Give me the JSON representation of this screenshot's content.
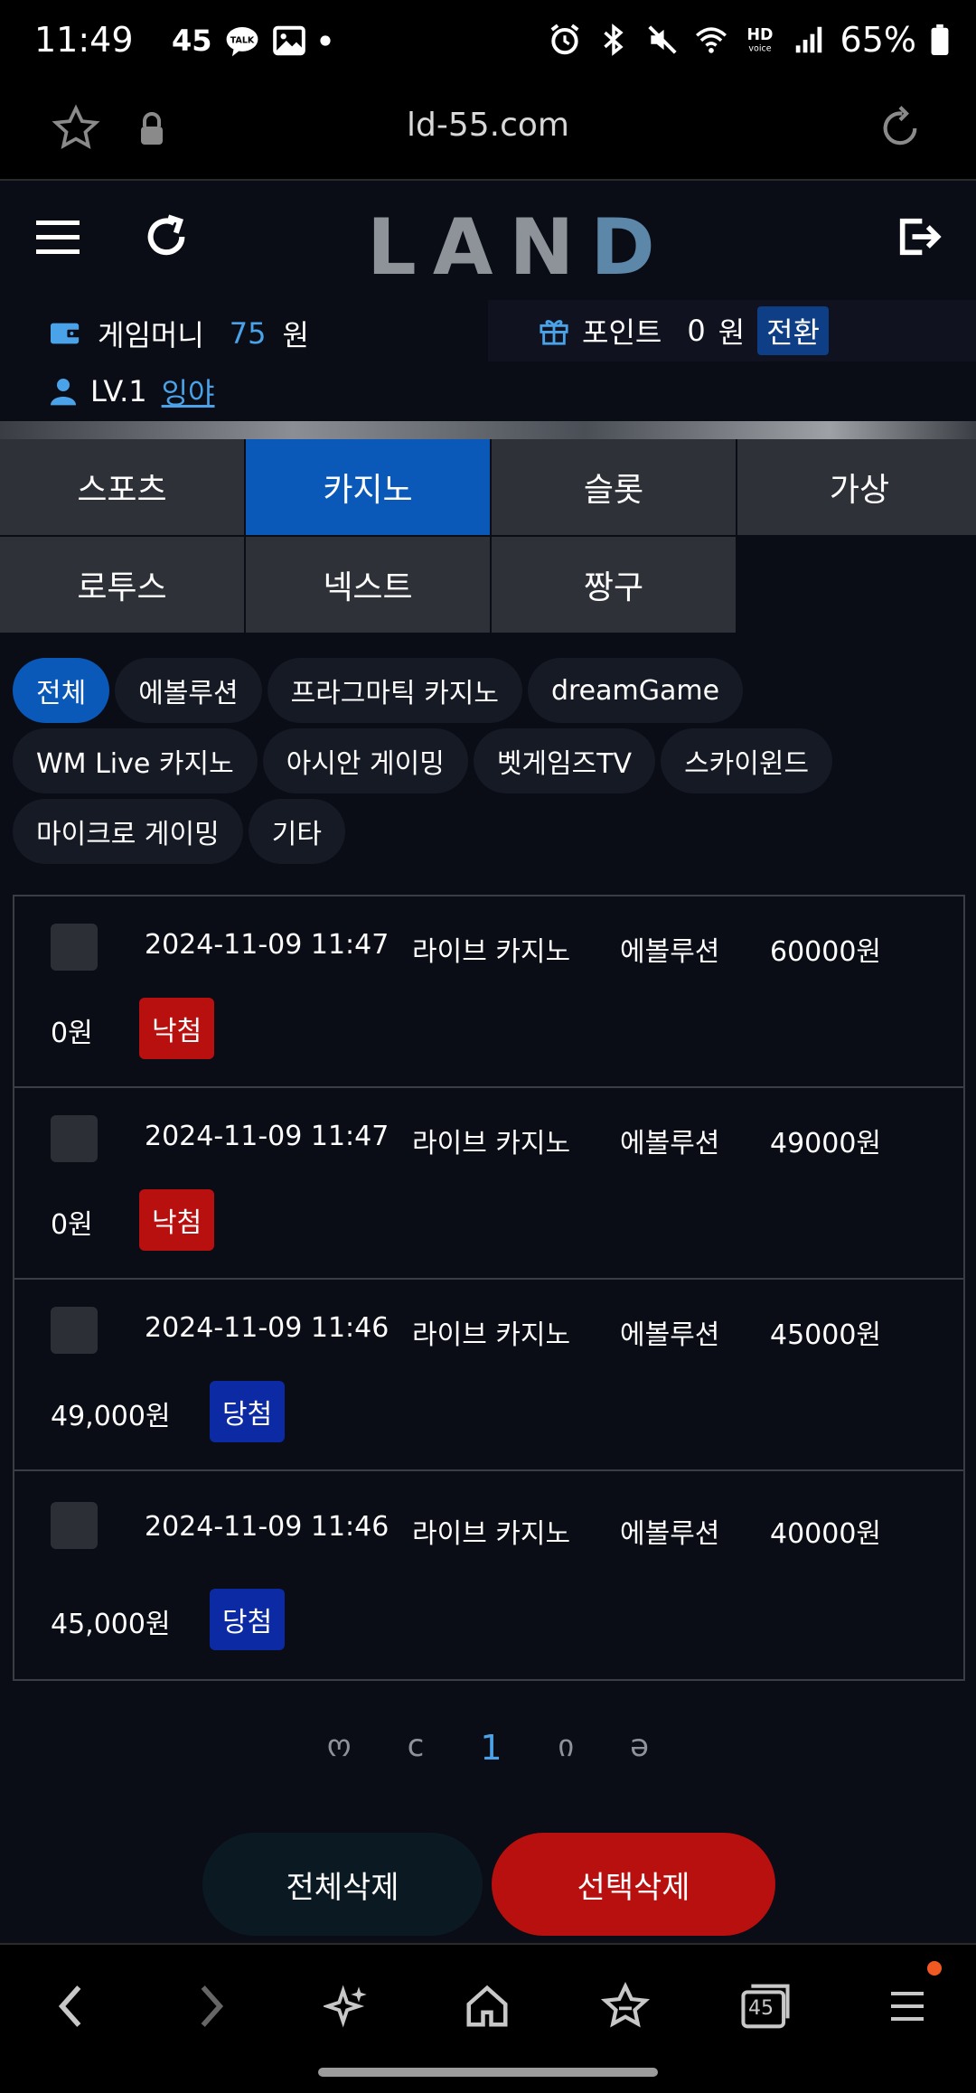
{
  "status": {
    "time": "11:49",
    "talk_count": "45",
    "battery": "65%"
  },
  "browser": {
    "url": "ld-55.com",
    "tab_count": "45"
  },
  "header": {
    "logo": "LAND"
  },
  "account": {
    "money_label": "게임머니",
    "money_value": "75",
    "money_unit": "원",
    "point_label": "포인트",
    "point_value": "0",
    "point_unit": "원",
    "convert_label": "전환",
    "level": "LV.1",
    "nickname": "잉야"
  },
  "categories": [
    {
      "label": "스포츠"
    },
    {
      "label": "카지노",
      "active": true
    },
    {
      "label": "슬롯"
    },
    {
      "label": "가상"
    },
    {
      "label": "로투스"
    },
    {
      "label": "넥스트"
    },
    {
      "label": "짱구"
    }
  ],
  "filters": [
    {
      "label": "전체",
      "active": true
    },
    {
      "label": "에볼루션"
    },
    {
      "label": "프라그마틱 카지노"
    },
    {
      "label": "dreamGame"
    },
    {
      "label": "WM Live 카지노"
    },
    {
      "label": "아시안 게이밍"
    },
    {
      "label": "벳게임즈TV"
    },
    {
      "label": "스카이윈드"
    },
    {
      "label": "마이크로 게이밍"
    },
    {
      "label": "기타"
    }
  ],
  "history": [
    {
      "date": "2024-11-09 11:47",
      "game": "라이브 카지노",
      "provider": "에볼루션",
      "bet": "60000원",
      "payout": "0원",
      "result": "낙첨",
      "result_type": "lose"
    },
    {
      "date": "2024-11-09 11:47",
      "game": "라이브 카지노",
      "provider": "에볼루션",
      "bet": "49000원",
      "payout": "0원",
      "result": "낙첨",
      "result_type": "lose"
    },
    {
      "date": "2024-11-09 11:46",
      "game": "라이브 카지노",
      "provider": "에볼루션",
      "bet": "45000원",
      "payout": "49,000원",
      "result": "당첨",
      "result_type": "win"
    },
    {
      "date": "2024-11-09 11:46",
      "game": "라이브 카지노",
      "provider": "에볼루션",
      "bet": "40000원",
      "payout": "45,000원",
      "result": "당첨",
      "result_type": "win"
    }
  ],
  "pagination": {
    "first": "ო",
    "prev": "c",
    "current": "1",
    "next": "ი",
    "last": "ə"
  },
  "actions": {
    "delete_all": "전체삭제",
    "delete_selected": "선택삭제"
  },
  "colors": {
    "accent_blue": "#0a59b8",
    "link_blue": "#4aa3e8",
    "lose_red": "#b80f0f",
    "win_blue": "#0c2aa3",
    "background": "#0a0c16"
  }
}
